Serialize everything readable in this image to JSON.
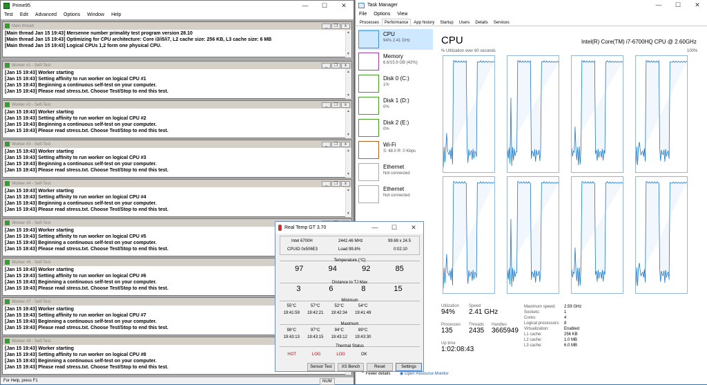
{
  "prime": {
    "title": "Prime95",
    "menu": [
      "Test",
      "Edit",
      "Advanced",
      "Options",
      "Window",
      "Help"
    ],
    "status": "For Help, press F1",
    "num": "NUM",
    "main": {
      "title": "Main thread",
      "lines": [
        "[Main thread Jan 15 19:43] Mersenne number primality test program version 28.10",
        "[Main thread Jan 15 19:43] Optimizing for CPU architecture: Core i3/i5/i7, L2 cache size: 256 KB, L3 cache size: 6 MB",
        "[Main thread Jan 15 19:43] Logical CPUs 1,2 form one physical CPU."
      ]
    },
    "workers": [
      {
        "title": "Worker #1 - Self-Test",
        "lines": [
          "[Jan 15 19:43] Worker starting",
          "[Jan 15 19:43] Setting affinity to run worker on logical CPU #1",
          "[Jan 15 19:43] Beginning a continuous self-test on your computer.",
          "[Jan 15 19:43] Please read stress.txt.  Choose Test/Stop to end this test."
        ]
      },
      {
        "title": "Worker #2 - Self-Test",
        "lines": [
          "[Jan 15 19:43] Worker starting",
          "[Jan 15 19:43] Setting affinity to run worker on logical CPU #2",
          "[Jan 15 19:43] Beginning a continuous self-test on your computer.",
          "[Jan 15 19:43] Please read stress.txt.  Choose Test/Stop to end this test."
        ]
      },
      {
        "title": "Worker #3 - Self-Test",
        "lines": [
          "[Jan 15 19:43] Worker starting",
          "[Jan 15 19:43] Setting affinity to run worker on logical CPU #3",
          "[Jan 15 19:43] Beginning a continuous self-test on your computer.",
          "[Jan 15 19:43] Please read stress.txt.  Choose Test/Stop to end this test."
        ]
      },
      {
        "title": "Worker #4 - Self-Test",
        "lines": [
          "[Jan 15 19:43] Worker starting",
          "[Jan 15 19:43] Setting affinity to run worker on logical CPU #4",
          "[Jan 15 19:43] Beginning a continuous self-test on your computer.",
          "[Jan 15 19:43] Please read stress.txt.  Choose Test/Stop to end this test."
        ]
      },
      {
        "title": "Worker #5 - Self-Test",
        "lines": [
          "[Jan 15 19:43] Worker starting",
          "[Jan 15 19:43] Setting affinity to run worker on logical CPU #5",
          "[Jan 15 19:43] Beginning a continuous self-test on your computer.",
          "[Jan 15 19:43] Please read stress.txt.  Choose Test/Stop to end this test."
        ]
      },
      {
        "title": "Worker #6 - Self-Test",
        "lines": [
          "[Jan 15 19:43] Worker starting",
          "[Jan 15 19:43] Setting affinity to run worker on logical CPU #6",
          "[Jan 15 19:43] Beginning a continuous self-test on your computer.",
          "[Jan 15 19:43] Please read stress.txt.  Choose Test/Stop to end this test."
        ]
      },
      {
        "title": "Worker #7 - Self-Test",
        "lines": [
          "[Jan 15 19:43] Worker starting",
          "[Jan 15 19:43] Setting affinity to run worker on logical CPU #7",
          "[Jan 15 19:43] Beginning a continuous self-test on your computer.",
          "[Jan 15 19:43] Please read stress.txt.  Choose Test/Stop to end this test."
        ]
      },
      {
        "title": "Worker #8 - Self-Test",
        "lines": [
          "[Jan 15 19:43] Worker starting",
          "[Jan 15 19:43] Setting affinity to run worker on logical CPU #8",
          "[Jan 15 19:43] Beginning a continuous self-test on your computer.",
          "[Jan 15 19:43] Please read stress.txt.  Choose Test/Stop to end this test."
        ]
      }
    ]
  },
  "tm": {
    "title": "Task Manager",
    "menu": [
      "File",
      "Options",
      "View"
    ],
    "tabs": [
      "Processes",
      "Performance",
      "App history",
      "Startup",
      "Users",
      "Details",
      "Services"
    ],
    "resources": [
      {
        "name": "CPU",
        "sub": "94%  2.41 GHz",
        "color": "#4a90c8"
      },
      {
        "name": "Memory",
        "sub": "6.6/15.9 GB (42%)",
        "color": "#a040a0"
      },
      {
        "name": "Disk 0 (C:)",
        "sub": "1%",
        "color": "#4a9a2a"
      },
      {
        "name": "Disk 1 (D:)",
        "sub": "0%",
        "color": "#4a9a2a"
      },
      {
        "name": "Disk 2 (E:)",
        "sub": "0%",
        "color": "#4a9a2a"
      },
      {
        "name": "Wi-Fi",
        "sub": "S: 48.0  R: 0 Kbps",
        "color": "#b06020"
      },
      {
        "name": "Ethernet",
        "sub": "Not connected",
        "color": "#aaaaaa"
      },
      {
        "name": "Ethernet",
        "sub": "Not connected",
        "color": "#aaaaaa"
      }
    ],
    "cpu_title": "CPU",
    "cpu_model": "Intel(R) Core(TM) i7-6700HQ CPU @ 2.60GHz",
    "graph_label": "% Utilization over 60 seconds",
    "graph_max": "100%",
    "util_l": "Utilization",
    "util": "94%",
    "speed_l": "Speed",
    "speed": "2.41 GHz",
    "proc_l": "Processes",
    "proc": "135",
    "thr_l": "Threads",
    "thr": "2435",
    "hnd_l": "Handles",
    "hnd": "3665949",
    "up_l": "Up time",
    "up": "1:02:08:43",
    "specs": [
      [
        "Maximum speed:",
        "2.59 GHz"
      ],
      [
        "Sockets:",
        "1"
      ],
      [
        "Cores:",
        "4"
      ],
      [
        "Logical processors:",
        "8"
      ],
      [
        "Virtualization:",
        "Enabled"
      ],
      [
        "L1 cache:",
        "256 KB"
      ],
      [
        "L2 cache:",
        "1.0 MB"
      ],
      [
        "L3 cache:",
        "6.0 MB"
      ]
    ],
    "fewer": "Fewer details",
    "orm": "Open Resource Monitor"
  },
  "rt": {
    "title": "Real Temp GT 3.70",
    "cpu": "Intel 6700H",
    "mhz": "2442.46 MHz",
    "mult": "99.69 x 24.5",
    "cpuid": "CPUID  0x506E3",
    "load": "Load  99.8%",
    "time": "0:02:10",
    "temp_t": "Temperature (°C)",
    "temps": [
      "97",
      "94",
      "92",
      "85"
    ],
    "dist_t": "Distance to TJ Max",
    "dist": [
      "3",
      "6",
      "8",
      "15"
    ],
    "min_t": "Minimum",
    "mins": [
      "55°C",
      "57°C",
      "52°C",
      "54°C"
    ],
    "min_times": [
      "19:41:59",
      "19:42:21",
      "19:42:34",
      "19:41:49"
    ],
    "max_t": "Maximum",
    "maxs": [
      "98°C",
      "97°C",
      "94°C",
      "89°C"
    ],
    "max_times": [
      "19:43:13",
      "19:43:15",
      "19:43:12",
      "19:43:30"
    ],
    "th_t": "Thermal Status",
    "ths": [
      "HOT",
      "LOG",
      "LOG",
      "OK"
    ],
    "buttons": [
      "Sensor Test",
      "XS Bench",
      "Reset",
      "Settings"
    ]
  }
}
